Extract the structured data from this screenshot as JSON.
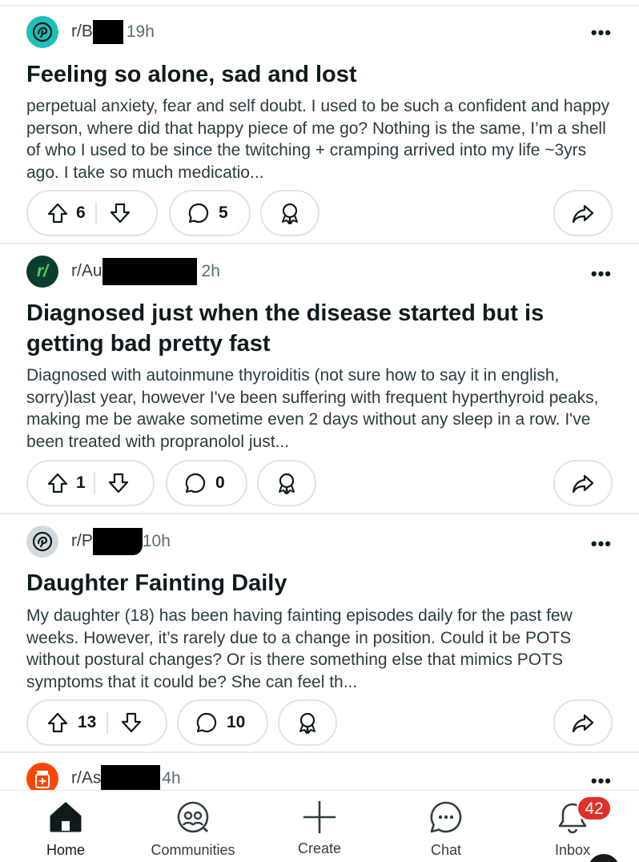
{
  "posts": [
    {
      "subreddit_prefix": "r/B",
      "age": "19h",
      "more": "•••",
      "title": "Feeling so alone, sad and lost",
      "body": "perpetual anxiety, fear and self doubt. I used to be such a confident and happy person, where did that happy piece of me go? Nothing is the same, I’m a shell of who I used to be since the twitching + cramping arrived into my life ~3yrs ago. I take so much medicatio...",
      "upvotes": "6",
      "comments": "5",
      "icon_color": "#1fbfb8",
      "icon": "brain-icon"
    },
    {
      "subreddit_prefix": "r/Au",
      "age": "2h",
      "more": "•••",
      "title": "Diagnosed just when the disease started but is getting bad pretty fast",
      "body": "Diagnosed with autoinmune thyroiditis (not sure how to say it in english, sorry)last year, however I've been suffering with frequent hyperthyroid peaks, making me be awake sometime even 2 days without any sleep in a row. I've been treated with propranolol just...",
      "upvotes": "1",
      "comments": "0",
      "icon_color": "#0b3d2e",
      "icon": "r-slash-icon",
      "icon_text": "r/"
    },
    {
      "subreddit_prefix": "r/P",
      "age": "10h",
      "more": "•••",
      "title": "Daughter Fainting Daily",
      "body": "My daughter (18) has been having fainting episodes daily for the past few weeks. However, it’s rarely due to a change in position. Could it be POTS without postural changes? Or is there something else that mimics POTS symptoms that it could be? She can feel th...",
      "upvotes": "13",
      "comments": "10",
      "icon_color": "#d3dadd",
      "icon": "brain-icon"
    },
    {
      "subreddit_prefix": "r/As",
      "age": "4h",
      "more": "•••",
      "icon_color": "#ff4500",
      "icon": "pill-bottle-icon"
    }
  ],
  "nav": {
    "home": "Home",
    "communities": "Communities",
    "create": "Create",
    "chat": "Chat",
    "inbox": "Inbox",
    "inbox_badge": "42"
  }
}
